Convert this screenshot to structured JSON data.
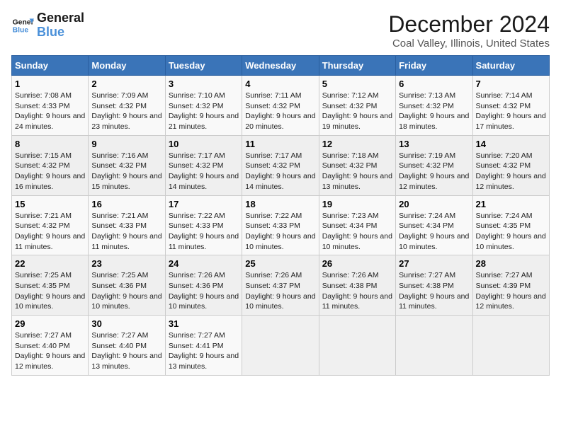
{
  "logo": {
    "line1": "General",
    "line2": "Blue"
  },
  "title": "December 2024",
  "subtitle": "Coal Valley, Illinois, United States",
  "headers": [
    "Sunday",
    "Monday",
    "Tuesday",
    "Wednesday",
    "Thursday",
    "Friday",
    "Saturday"
  ],
  "weeks": [
    [
      {
        "day": "1",
        "sunrise": "7:08 AM",
        "sunset": "4:33 PM",
        "daylight": "9 hours and 24 minutes."
      },
      {
        "day": "2",
        "sunrise": "7:09 AM",
        "sunset": "4:32 PM",
        "daylight": "9 hours and 23 minutes."
      },
      {
        "day": "3",
        "sunrise": "7:10 AM",
        "sunset": "4:32 PM",
        "daylight": "9 hours and 21 minutes."
      },
      {
        "day": "4",
        "sunrise": "7:11 AM",
        "sunset": "4:32 PM",
        "daylight": "9 hours and 20 minutes."
      },
      {
        "day": "5",
        "sunrise": "7:12 AM",
        "sunset": "4:32 PM",
        "daylight": "9 hours and 19 minutes."
      },
      {
        "day": "6",
        "sunrise": "7:13 AM",
        "sunset": "4:32 PM",
        "daylight": "9 hours and 18 minutes."
      },
      {
        "day": "7",
        "sunrise": "7:14 AM",
        "sunset": "4:32 PM",
        "daylight": "9 hours and 17 minutes."
      }
    ],
    [
      {
        "day": "8",
        "sunrise": "7:15 AM",
        "sunset": "4:32 PM",
        "daylight": "9 hours and 16 minutes."
      },
      {
        "day": "9",
        "sunrise": "7:16 AM",
        "sunset": "4:32 PM",
        "daylight": "9 hours and 15 minutes."
      },
      {
        "day": "10",
        "sunrise": "7:17 AM",
        "sunset": "4:32 PM",
        "daylight": "9 hours and 14 minutes."
      },
      {
        "day": "11",
        "sunrise": "7:17 AM",
        "sunset": "4:32 PM",
        "daylight": "9 hours and 14 minutes."
      },
      {
        "day": "12",
        "sunrise": "7:18 AM",
        "sunset": "4:32 PM",
        "daylight": "9 hours and 13 minutes."
      },
      {
        "day": "13",
        "sunrise": "7:19 AM",
        "sunset": "4:32 PM",
        "daylight": "9 hours and 12 minutes."
      },
      {
        "day": "14",
        "sunrise": "7:20 AM",
        "sunset": "4:32 PM",
        "daylight": "9 hours and 12 minutes."
      }
    ],
    [
      {
        "day": "15",
        "sunrise": "7:21 AM",
        "sunset": "4:32 PM",
        "daylight": "9 hours and 11 minutes."
      },
      {
        "day": "16",
        "sunrise": "7:21 AM",
        "sunset": "4:33 PM",
        "daylight": "9 hours and 11 minutes."
      },
      {
        "day": "17",
        "sunrise": "7:22 AM",
        "sunset": "4:33 PM",
        "daylight": "9 hours and 11 minutes."
      },
      {
        "day": "18",
        "sunrise": "7:22 AM",
        "sunset": "4:33 PM",
        "daylight": "9 hours and 10 minutes."
      },
      {
        "day": "19",
        "sunrise": "7:23 AM",
        "sunset": "4:34 PM",
        "daylight": "9 hours and 10 minutes."
      },
      {
        "day": "20",
        "sunrise": "7:24 AM",
        "sunset": "4:34 PM",
        "daylight": "9 hours and 10 minutes."
      },
      {
        "day": "21",
        "sunrise": "7:24 AM",
        "sunset": "4:35 PM",
        "daylight": "9 hours and 10 minutes."
      }
    ],
    [
      {
        "day": "22",
        "sunrise": "7:25 AM",
        "sunset": "4:35 PM",
        "daylight": "9 hours and 10 minutes."
      },
      {
        "day": "23",
        "sunrise": "7:25 AM",
        "sunset": "4:36 PM",
        "daylight": "9 hours and 10 minutes."
      },
      {
        "day": "24",
        "sunrise": "7:26 AM",
        "sunset": "4:36 PM",
        "daylight": "9 hours and 10 minutes."
      },
      {
        "day": "25",
        "sunrise": "7:26 AM",
        "sunset": "4:37 PM",
        "daylight": "9 hours and 10 minutes."
      },
      {
        "day": "26",
        "sunrise": "7:26 AM",
        "sunset": "4:38 PM",
        "daylight": "9 hours and 11 minutes."
      },
      {
        "day": "27",
        "sunrise": "7:27 AM",
        "sunset": "4:38 PM",
        "daylight": "9 hours and 11 minutes."
      },
      {
        "day": "28",
        "sunrise": "7:27 AM",
        "sunset": "4:39 PM",
        "daylight": "9 hours and 12 minutes."
      }
    ],
    [
      {
        "day": "29",
        "sunrise": "7:27 AM",
        "sunset": "4:40 PM",
        "daylight": "9 hours and 12 minutes."
      },
      {
        "day": "30",
        "sunrise": "7:27 AM",
        "sunset": "4:40 PM",
        "daylight": "9 hours and 13 minutes."
      },
      {
        "day": "31",
        "sunrise": "7:27 AM",
        "sunset": "4:41 PM",
        "daylight": "9 hours and 13 minutes."
      },
      null,
      null,
      null,
      null
    ]
  ]
}
